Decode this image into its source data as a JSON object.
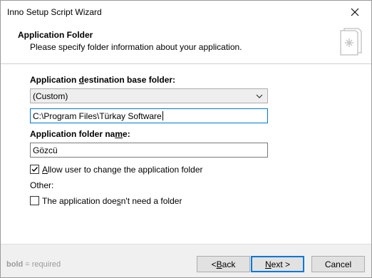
{
  "window": {
    "title": "Inno Setup Script Wizard"
  },
  "header": {
    "title": "Application Folder",
    "subtitle": "Please specify folder information about your application."
  },
  "form": {
    "dest_base_label_parts": [
      "Application ",
      "d",
      "estination base folder:"
    ],
    "dest_base_selected": "(Custom)",
    "custom_path_value": "C:\\Program Files\\Türkay Software",
    "folder_name_label_parts": [
      "Application folder na",
      "m",
      "e:"
    ],
    "folder_name_value": "Gözcü",
    "allow_change_label_parts": [
      "",
      "A",
      "llow user to change the application folder"
    ],
    "allow_change_checked": true,
    "other_label": "Other:",
    "no_folder_label_parts": [
      "The application doe",
      "s",
      "n't need a folder"
    ],
    "no_folder_checked": false
  },
  "footer": {
    "note_bold": "bold",
    "note_rest": " = required",
    "back_parts": [
      "< ",
      "B",
      "ack"
    ],
    "next_parts": [
      "",
      "N",
      "ext >"
    ],
    "cancel_label": "Cancel"
  },
  "icons": {
    "close": "close-icon",
    "wizard": "wizard-page-icon",
    "dropdown": "chevron-down-icon",
    "check": "checkmark-icon"
  }
}
